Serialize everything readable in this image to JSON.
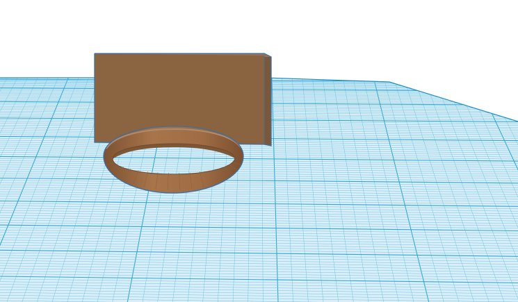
{
  "viewport": {
    "background": "#ffffff"
  },
  "workplane": {
    "fill": "#d9eef8",
    "grid_minor_color": "#6fc3e3",
    "grid_major_color": "#2fa6d6",
    "edge_color": "#1e8fc2"
  },
  "shapes": [
    {
      "kind": "box",
      "color": "#8b6442",
      "edge_color": "#3d6fa3"
    },
    {
      "kind": "ring",
      "color": "#9a6a43",
      "edge_color": "#3d6fa3"
    }
  ]
}
